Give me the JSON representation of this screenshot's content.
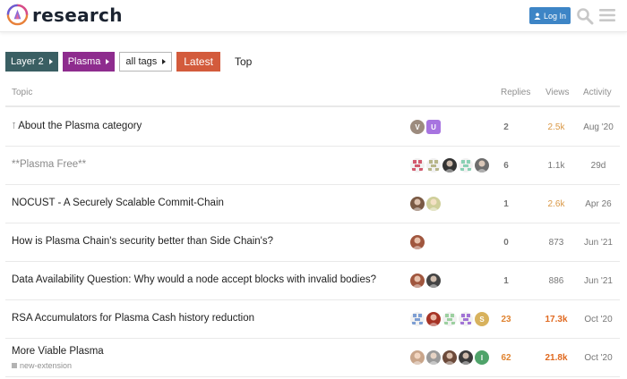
{
  "header": {
    "site_name": "research",
    "login_label": "Log In"
  },
  "nav": {
    "category_parent": "Layer 2",
    "category": "Plasma",
    "tags_filter": "all tags",
    "tab_latest": "Latest",
    "tab_top": "Top"
  },
  "table": {
    "col_topic": "Topic",
    "col_replies": "Replies",
    "col_views": "Views",
    "col_activity": "Activity"
  },
  "topics": [
    {
      "title": "About the Plasma category",
      "pinned": true,
      "replies": "2",
      "views": "2.5k",
      "activity": "Aug '20",
      "posters": [
        {
          "kind": "letter",
          "text": "V",
          "color": "#9c8b7e"
        },
        {
          "kind": "letter-sq",
          "text": "U",
          "color": "#a774e0"
        }
      ]
    },
    {
      "title": "**Plasma Free**",
      "faded": true,
      "replies": "6",
      "views": "1.1k",
      "activity": "29d",
      "posters": [
        {
          "kind": "identicon",
          "color": "#d25a6e"
        },
        {
          "kind": "identicon",
          "color": "#b7b68a"
        },
        {
          "kind": "photo",
          "color": "#333333"
        },
        {
          "kind": "identicon",
          "color": "#8ad0b4"
        },
        {
          "kind": "photo",
          "color": "#6d6d6d"
        }
      ]
    },
    {
      "title": "NOCUST - A Securely Scalable Commit-Chain",
      "replies": "1",
      "views": "2.6k",
      "activity": "Apr 26",
      "posters": [
        {
          "kind": "photo",
          "color": "#7a5a44"
        },
        {
          "kind": "photo",
          "color": "#cfcf9a"
        }
      ]
    },
    {
      "title": "How is Plasma Chain's security better than Side Chain's?",
      "replies": "0",
      "views": "873",
      "activity": "Jun '21",
      "posters": [
        {
          "kind": "photo",
          "color": "#a0563e"
        }
      ]
    },
    {
      "title": "Data Availability Question: Why would a node accept blocks with invalid bodies?",
      "replies": "1",
      "views": "886",
      "activity": "Jun '21",
      "posters": [
        {
          "kind": "photo",
          "color": "#a0563e"
        },
        {
          "kind": "photo",
          "color": "#444444"
        }
      ]
    },
    {
      "title": "RSA Accumulators for Plasma Cash history reduction",
      "replies": "23",
      "views": "17.3k",
      "activity": "Oct '20",
      "posters": [
        {
          "kind": "identicon",
          "color": "#7e9fd3"
        },
        {
          "kind": "photo",
          "color": "#a63325"
        },
        {
          "kind": "identicon",
          "color": "#9cd0a0"
        },
        {
          "kind": "identicon",
          "color": "#a274d6"
        },
        {
          "kind": "letter",
          "text": "S",
          "color": "#d8b25d"
        }
      ]
    },
    {
      "title": "More Viable Plasma",
      "tag": "new-extension",
      "replies": "62",
      "views": "21.8k",
      "activity": "Oct '20",
      "posters": [
        {
          "kind": "photo",
          "color": "#c9a58a"
        },
        {
          "kind": "photo",
          "color": "#9a9a9a"
        },
        {
          "kind": "photo",
          "color": "#6c4a3a"
        },
        {
          "kind": "photo",
          "color": "#3b3b3b"
        },
        {
          "kind": "letter",
          "text": "I",
          "color": "#4fa36a"
        }
      ]
    }
  ]
}
